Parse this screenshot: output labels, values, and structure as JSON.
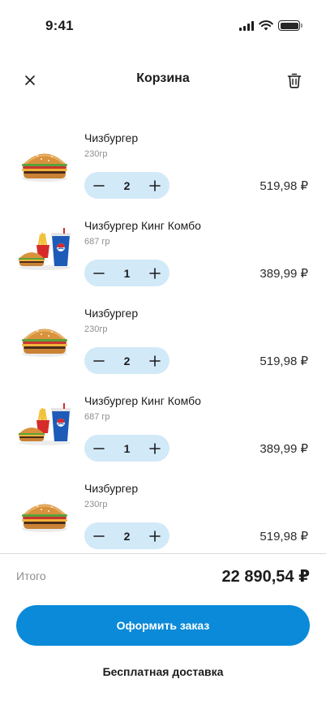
{
  "status_bar": {
    "time": "9:41"
  },
  "header": {
    "title": "Корзина"
  },
  "items": [
    {
      "name": "Чизбургер",
      "weight": "230гр",
      "quantity": "2",
      "price": "519,98 ₽",
      "image": "cheeseburger"
    },
    {
      "name": "Чизбургер Кинг Комбо",
      "weight": "687 гр",
      "quantity": "1",
      "price": "389,99 ₽",
      "image": "combo"
    },
    {
      "name": "Чизбургер",
      "weight": "230гр",
      "quantity": "2",
      "price": "519,98 ₽",
      "image": "cheeseburger"
    },
    {
      "name": "Чизбургер Кинг Комбо",
      "weight": "687 гр",
      "quantity": "1",
      "price": "389,99 ₽",
      "image": "combo"
    },
    {
      "name": "Чизбургер",
      "weight": "230гр",
      "quantity": "2",
      "price": "519,98 ₽",
      "image": "cheeseburger"
    }
  ],
  "summary": {
    "total_label": "Итого",
    "total_value": "22 890,54 ₽"
  },
  "actions": {
    "checkout_label": "Оформить заказ",
    "delivery_label": "Бесплатная доставка"
  },
  "colors": {
    "accent": "#0a8ad8",
    "stepper_bg": "#d2e9f8"
  }
}
